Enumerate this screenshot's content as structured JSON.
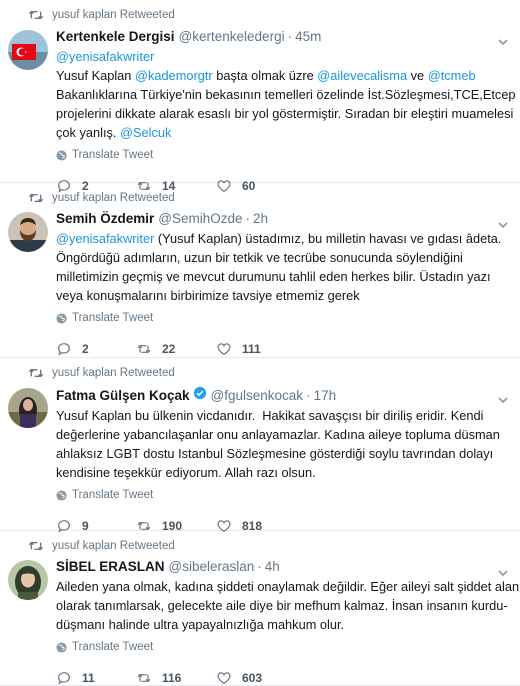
{
  "tweets": [
    {
      "retweeted_by": "yusuf kaplan Retweeted",
      "name": "Kertenkele Dergisi",
      "handle": "@kertenkeledergi",
      "time": "45m",
      "lines": [
        [
          {
            "t": "@yenisafakwriter",
            "link": true
          }
        ],
        [
          {
            "t": "Yusuf Kaplan "
          },
          {
            "t": "@kademorgtr",
            "link": true
          },
          {
            "t": " başta olmak üzre "
          },
          {
            "t": "@ailevecalisma",
            "link": true
          },
          {
            "t": " ve "
          },
          {
            "t": "@tcmeb",
            "link": true
          }
        ],
        [
          {
            "t": "Bakanlıklarına Türkiye'nin bekasının temelleri özelinde İst.Sözleşmesi,TCE,Etcep"
          }
        ],
        [
          {
            "t": "projelerini dikkate alarak esaslı bir yol göstermiştir. Sıradan bir eleştiri muamelesi"
          }
        ],
        [
          {
            "t": "çok yanlış. "
          },
          {
            "t": "@Selcuk",
            "link": true
          }
        ]
      ],
      "translate": "Translate Tweet",
      "replies": "2",
      "retweets": "14",
      "likes": "60",
      "verified": false
    },
    {
      "retweeted_by": "yusuf kaplan Retweeted",
      "name": "Semih Özdemir",
      "handle": "@SemihOzde",
      "time": "2h",
      "lines": [
        [
          {
            "t": "@yenisafakwriter",
            "link": true
          },
          {
            "t": " (Yusuf Kaplan) üstadımız, bu milletin havası ve gıdası âdeta."
          }
        ],
        [
          {
            "t": "Öngördüğü adımların, uzun bir tetkik ve tecrübe sonucunda söylendiğini"
          }
        ],
        [
          {
            "t": "milletimizin geçmiş ve mevcut durumunu tahlil eden herkes bilir. Üstadın yazı"
          }
        ],
        [
          {
            "t": "veya konuşmalarını birbirimize tavsiye etmemiz gerek"
          }
        ]
      ],
      "translate": "Translate Tweet",
      "replies": "2",
      "retweets": "22",
      "likes": "111",
      "verified": false
    },
    {
      "retweeted_by": "yusuf kaplan Retweeted",
      "name": "Fatma Gülşen Koçak",
      "handle": "@fgulsenkocak",
      "time": "17h",
      "lines": [
        [
          {
            "t": "Yusuf Kaplan bu ülkenin vicdanıdır.  Hakikat savaşçısı bir diriliş eridir. Kendi"
          }
        ],
        [
          {
            "t": "değerlerine yabancılaşanlar onu anlayamazlar. Kadına aileye topluma düsman"
          }
        ],
        [
          {
            "t": "ahlaksız LGBT dostu Istanbul Sözleşmesine gösterdiği soylu tavrından dolayı"
          }
        ],
        [
          {
            "t": "kendisine teşekkür ediyorum. Allah razı olsun."
          }
        ]
      ],
      "translate": "Translate Tweet",
      "replies": "9",
      "retweets": "190",
      "likes": "818",
      "verified": true
    },
    {
      "retweeted_by": "yusuf kaplan Retweeted",
      "name": "SİBEL ERASLAN",
      "handle": "@sibeleraslan",
      "time": "4h",
      "lines": [
        [
          {
            "t": "Aileden yana olmak, kadına şiddeti onaylamak değildir. Eğer aileyi salt şiddet alanı"
          }
        ],
        [
          {
            "t": "olarak tanımlarsak, gelecekte aile diye bir mefhum kalmaz. İnsan insanın kurdu-"
          }
        ],
        [
          {
            "t": "düşmanı halinde ultra yapayalnızlığa mahkum olur."
          }
        ]
      ],
      "translate": "Translate Tweet",
      "replies": "11",
      "retweets": "116",
      "likes": "603",
      "verified": false
    }
  ],
  "colors": {
    "link": "#1b95e0",
    "secondary_text": "#657786",
    "primary_text": "#14171a",
    "verified": "#1da1f2",
    "divider": "#e6ecf0"
  }
}
